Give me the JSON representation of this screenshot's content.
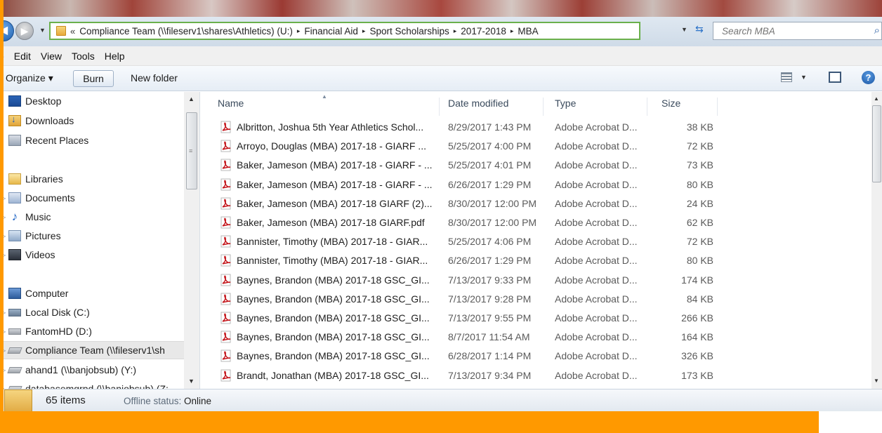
{
  "address": {
    "chevrons": "«",
    "crumbs": [
      "Compliance Team (\\\\fileserv1\\shares\\Athletics) (U:)",
      "Financial Aid",
      "Sport Scholarships",
      "2017-2018",
      "MBA"
    ],
    "separator": "▸"
  },
  "search": {
    "placeholder": "Search MBA"
  },
  "menu": {
    "file": "e",
    "edit": "Edit",
    "view": "View",
    "tools": "Tools",
    "help": "Help"
  },
  "toolbar": {
    "organize": "Organize ▾",
    "burn": "Burn",
    "new_folder": "New folder"
  },
  "nav": {
    "items": [
      {
        "label": "Desktop",
        "icon": "desktop-icon"
      },
      {
        "label": "Downloads",
        "icon": "downloads-icon"
      },
      {
        "label": "Recent Places",
        "icon": "recent-places-icon"
      },
      {
        "label": "Libraries",
        "icon": "libraries-icon"
      },
      {
        "label": "Documents",
        "icon": "documents-icon"
      },
      {
        "label": "Music",
        "icon": "music-icon"
      },
      {
        "label": "Pictures",
        "icon": "pictures-icon"
      },
      {
        "label": "Videos",
        "icon": "videos-icon"
      },
      {
        "label": "Computer",
        "icon": "computer-icon"
      },
      {
        "label": "Local Disk (C:)",
        "icon": "disk-icon"
      },
      {
        "label": "FantomHD (D:)",
        "icon": "drive-icon"
      },
      {
        "label": "Compliance Team (\\\\fileserv1\\sh",
        "icon": "network-drive-icon"
      },
      {
        "label": "ahand1 (\\\\banjobsub) (Y:)",
        "icon": "network-drive-icon"
      },
      {
        "label": "databasemgrpd (\\\\banjobsub) (Z:",
        "icon": "network-drive-icon"
      }
    ]
  },
  "columns": {
    "name": "Name",
    "date": "Date modified",
    "type": "Type",
    "size": "Size"
  },
  "files": [
    {
      "name": "Albritton, Joshua 5th Year Athletics Schol...",
      "date": "8/29/2017 1:43 PM",
      "type": "Adobe Acrobat D...",
      "size": "38 KB"
    },
    {
      "name": "Arroyo, Douglas (MBA) 2017-18 - GIARF ...",
      "date": "5/25/2017 4:00 PM",
      "type": "Adobe Acrobat D...",
      "size": "72 KB"
    },
    {
      "name": "Baker, Jameson (MBA) 2017-18 - GIARF - ...",
      "date": "5/25/2017 4:01 PM",
      "type": "Adobe Acrobat D...",
      "size": "73 KB"
    },
    {
      "name": "Baker, Jameson (MBA) 2017-18 - GIARF - ...",
      "date": "6/26/2017 1:29 PM",
      "type": "Adobe Acrobat D...",
      "size": "80 KB"
    },
    {
      "name": "Baker, Jameson (MBA) 2017-18 GIARF (2)...",
      "date": "8/30/2017 12:00 PM",
      "type": "Adobe Acrobat D...",
      "size": "24 KB"
    },
    {
      "name": "Baker, Jameson (MBA) 2017-18 GIARF.pdf",
      "date": "8/30/2017 12:00 PM",
      "type": "Adobe Acrobat D...",
      "size": "62 KB"
    },
    {
      "name": "Bannister, Timothy (MBA) 2017-18 - GIAR...",
      "date": "5/25/2017 4:06 PM",
      "type": "Adobe Acrobat D...",
      "size": "72 KB"
    },
    {
      "name": "Bannister, Timothy (MBA) 2017-18 - GIAR...",
      "date": "6/26/2017 1:29 PM",
      "type": "Adobe Acrobat D...",
      "size": "80 KB"
    },
    {
      "name": "Baynes, Brandon (MBA) 2017-18 GSC_GI...",
      "date": "7/13/2017 9:33 PM",
      "type": "Adobe Acrobat D...",
      "size": "174 KB"
    },
    {
      "name": "Baynes, Brandon (MBA) 2017-18 GSC_GI...",
      "date": "7/13/2017 9:28 PM",
      "type": "Adobe Acrobat D...",
      "size": "84 KB"
    },
    {
      "name": "Baynes, Brandon (MBA) 2017-18 GSC_GI...",
      "date": "7/13/2017 9:55 PM",
      "type": "Adobe Acrobat D...",
      "size": "266 KB"
    },
    {
      "name": "Baynes, Brandon (MBA) 2017-18 GSC_GI...",
      "date": "8/7/2017 11:54 AM",
      "type": "Adobe Acrobat D...",
      "size": "164 KB"
    },
    {
      "name": "Baynes, Brandon (MBA) 2017-18 GSC_GI...",
      "date": "6/28/2017 1:14 PM",
      "type": "Adobe Acrobat D...",
      "size": "326 KB"
    },
    {
      "name": "Brandt, Jonathan (MBA) 2017-18 GSC_GI...",
      "date": "7/13/2017 9:34 PM",
      "type": "Adobe Acrobat D...",
      "size": "173 KB"
    }
  ],
  "status": {
    "count": "65 items",
    "offline_label": "Offline status:",
    "offline_value": "Online"
  },
  "colors": {
    "accent_orange": "#ff9900",
    "address_border": "#6ab04c",
    "pdf_red": "#c4161c"
  }
}
